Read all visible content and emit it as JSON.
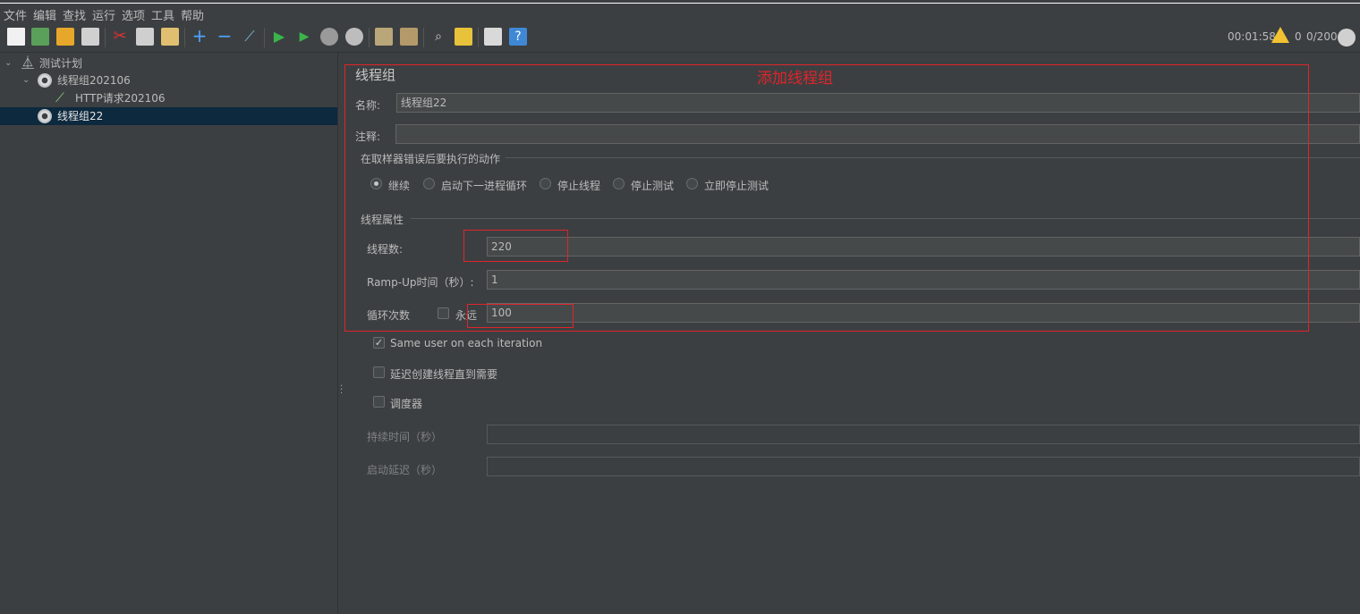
{
  "menu": [
    "文件",
    "编辑",
    "查找",
    "运行",
    "选项",
    "工具",
    "帮助"
  ],
  "status": {
    "elapsed": "00:01:58",
    "warnings": "0",
    "threads": "0/200"
  },
  "tree": {
    "root": "测试计划",
    "group1": "线程组202106",
    "http": "HTTP请求202106",
    "group2": "线程组22"
  },
  "panel": {
    "title": "线程组",
    "annotation": "添加线程组",
    "name_label": "名称:",
    "name_value": "线程组22",
    "comment_label": "注释:",
    "comment_value": "",
    "on_error_title": "在取样器错误后要执行的动作",
    "on_error_options": [
      "继续",
      "启动下一进程循环",
      "停止线程",
      "停止测试",
      "立即停止测试"
    ],
    "on_error_selected": "继续",
    "thread_props_title": "线程属性",
    "threads_label": "线程数:",
    "threads_value": "220",
    "rampup_label": "Ramp-Up时间（秒）:",
    "rampup_value": "1",
    "loop_label": "循环次数",
    "forever_label": "永远",
    "forever_checked": false,
    "loop_value": "100",
    "same_user_label": "Same user on each iteration",
    "same_user_checked": true,
    "delay_label": "延迟创建线程直到需要",
    "delay_checked": false,
    "scheduler_label": "调度器",
    "scheduler_checked": false,
    "duration_label": "持续时间（秒）",
    "duration_value": "",
    "startup_delay_label": "启动延迟（秒）",
    "startup_delay_value": ""
  },
  "colors": {
    "accent": "#e0242a",
    "selection": "#0d293e",
    "background": "#3c3f41"
  }
}
